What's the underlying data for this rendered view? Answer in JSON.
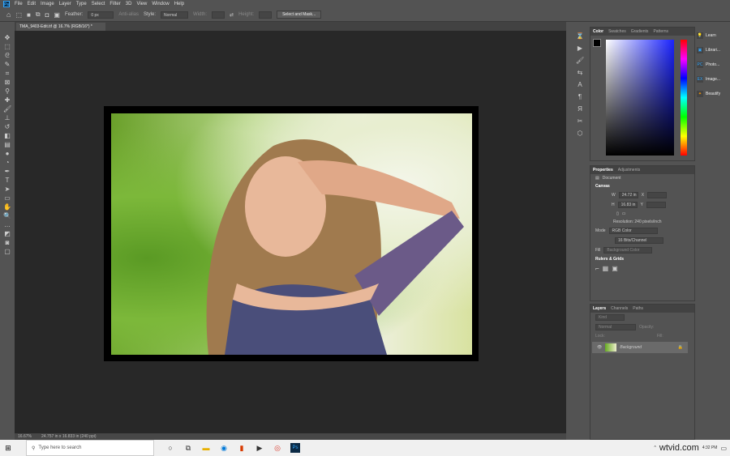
{
  "app": {
    "logo": "Ps"
  },
  "menu": [
    "File",
    "Edit",
    "Image",
    "Layer",
    "Type",
    "Select",
    "Filter",
    "3D",
    "View",
    "Window",
    "Help"
  ],
  "options": {
    "feather_label": "Feather:",
    "feather_value": "0 px",
    "antialias": "Anti-alias",
    "style_label": "Style:",
    "style_value": "Normal",
    "width_label": "Width:",
    "height_label": "Height:",
    "select_mask": "Select and Mask..."
  },
  "document": {
    "tab": "TMA_9403-Edit.tif @ 16.7% (RGB/16*) *",
    "zoom": "16.67%",
    "dims": "24.757 in x 16.833 in (240 ppi)"
  },
  "color_panel": {
    "tabs": [
      "Color",
      "Swatches",
      "Gradients",
      "Patterns"
    ]
  },
  "properties": {
    "tabs": [
      "Properties",
      "Adjustments"
    ],
    "type": "Document",
    "section": "Canvas",
    "w_label": "W",
    "w": "24.72 in",
    "h_label": "H",
    "h": "16.83 in",
    "x_label": "X",
    "y_label": "Y",
    "resolution": "Resolution: 240 pixels/inch",
    "mode_label": "Mode",
    "mode": "RGB Color",
    "depth": "16 Bits/Channel",
    "fill_label": "Fill",
    "fill": "Background Color",
    "rulers": "Rulers & Grids"
  },
  "layers": {
    "tabs": [
      "Layers",
      "Channels",
      "Paths"
    ],
    "kind": "Kind",
    "blend": "Normal",
    "opacity_label": "Opacity:",
    "lock_label": "Lock:",
    "fill_label": "Fill:",
    "layer_name": "Background"
  },
  "right": [
    "Learn",
    "Librari...",
    "Photo...",
    "Image...",
    "Beautify"
  ],
  "taskbar": {
    "search": "Type here to search",
    "watermark": "wtvid.com",
    "time": "4:32 PM"
  }
}
